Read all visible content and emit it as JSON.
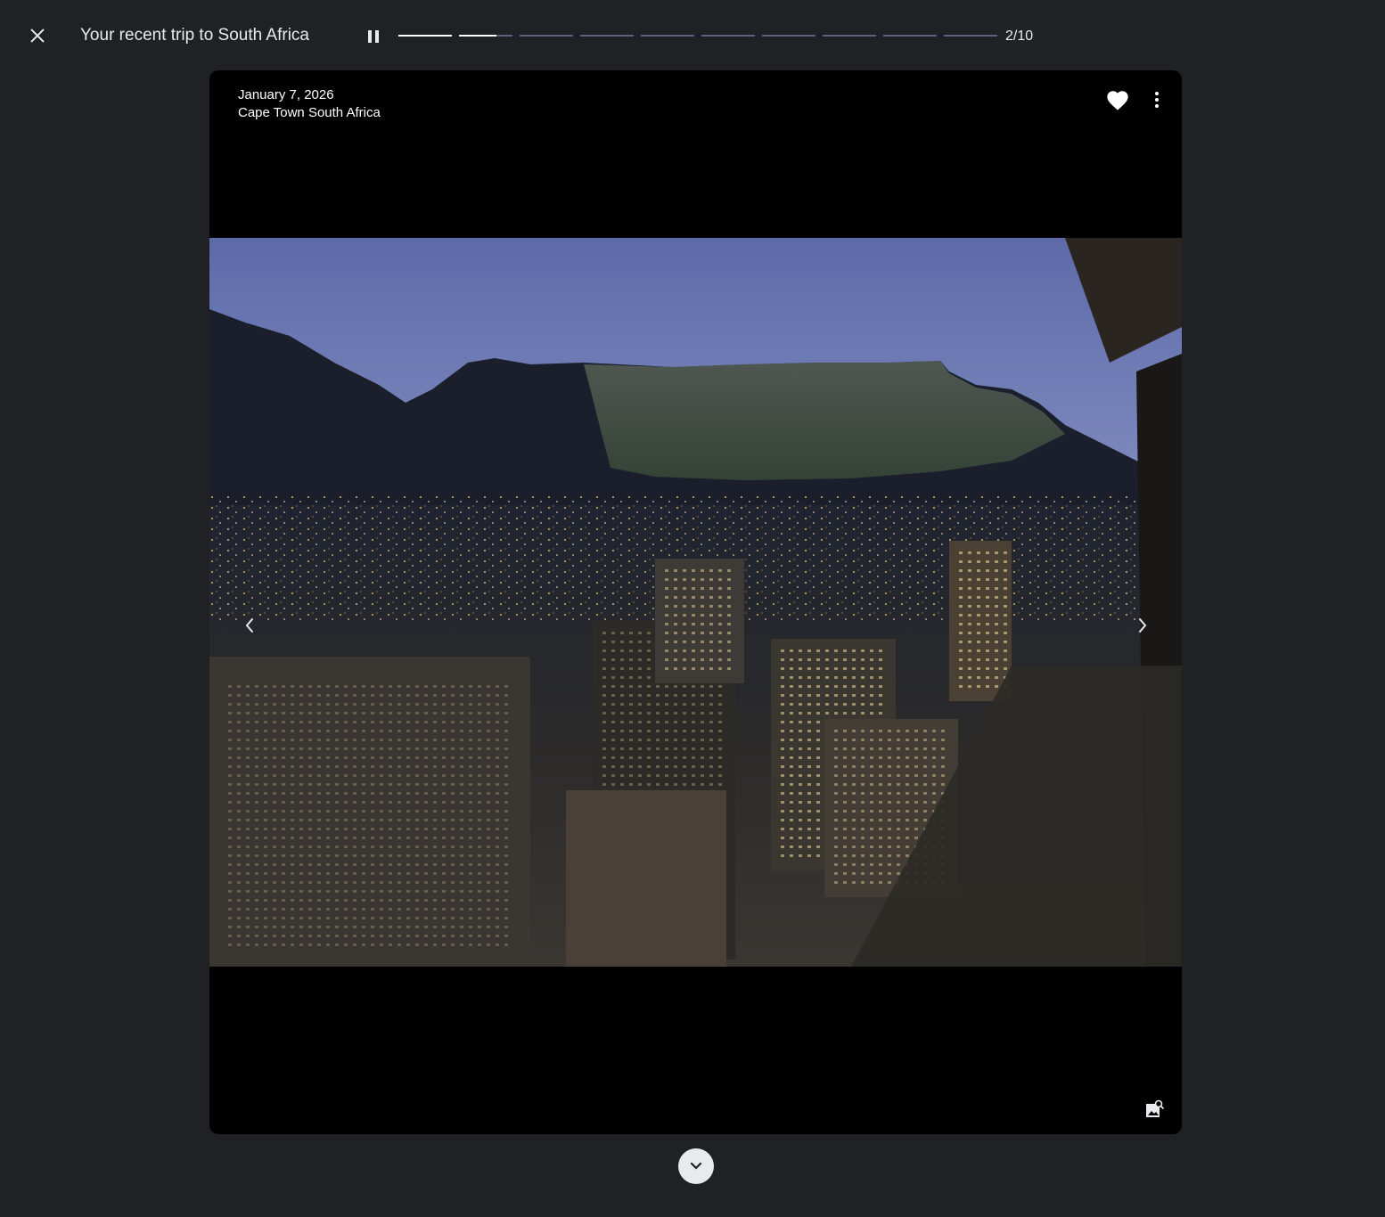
{
  "header": {
    "title": "Your recent trip to South Africa",
    "counter": "2/10",
    "progress": {
      "total_segments": 10,
      "current_index": 2,
      "current_segment_fill": 0.7
    }
  },
  "photo": {
    "date": "January 7, 2026",
    "location": "Cape Town South Africa"
  },
  "icons": {
    "close": "close-icon",
    "pause": "pause-icon",
    "favorite": "heart-icon",
    "more": "more-vert-icon",
    "prev": "chevron-left-icon",
    "next": "chevron-right-icon",
    "people": "image-search-icon",
    "expand": "chevron-down-icon"
  },
  "colors": {
    "background": "#202124",
    "progress_active": "#ffffff",
    "progress_inactive": "#5f6080"
  }
}
